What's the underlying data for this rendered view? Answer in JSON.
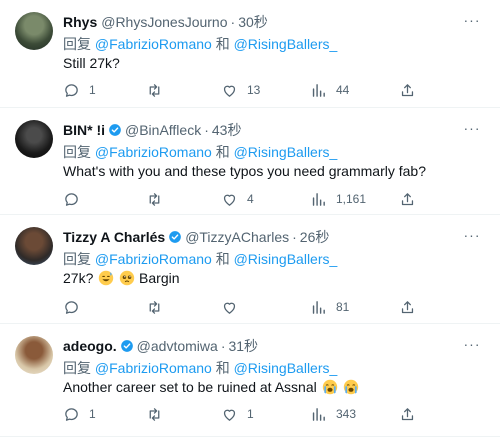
{
  "labels": {
    "reply_prefix": "回复",
    "and": "和",
    "more": "···"
  },
  "colors": {
    "accent": "#1d9bf0",
    "muted": "#536471",
    "text": "#0f1419"
  },
  "tweets": [
    {
      "name": "Rhys",
      "handle": "@RhysJonesJourno",
      "time": "30秒",
      "reply_to": [
        "@FabrizioRomano",
        "@RisingBallers_"
      ],
      "text": "Still 27k?",
      "emoji": [],
      "replies": "1",
      "retweets": "",
      "likes": "13",
      "views": "44",
      "icons": [
        "reply-icon",
        "retweet-icon",
        "like-icon",
        "views-icon",
        "share-icon"
      ]
    },
    {
      "name": "BIN* !i",
      "handle": "@BinAffleck",
      "time": "43秒",
      "reply_to": [
        "@FabrizioRomano",
        "@RisingBallers_"
      ],
      "text": "What's with you and these typos you need grammarly fab?",
      "emoji": [],
      "replies": "",
      "retweets": "",
      "likes": "4",
      "views": "1,161"
    },
    {
      "name": "Tizzy A Charlés",
      "handle": "@TizzyACharles",
      "time": "26秒",
      "reply_to": [
        "@FabrizioRomano",
        "@RisingBallers_"
      ],
      "text_before": "27k?",
      "text_after": "Bargin",
      "emoji": [
        "sweat-smile-emoji",
        "pleading-face-emoji"
      ],
      "replies": "",
      "retweets": "",
      "likes": "",
      "views": "81"
    },
    {
      "name": "adeogo.",
      "handle": "@advtomiwa",
      "time": "31秒",
      "reply_to": [
        "@FabrizioRomano",
        "@RisingBallers_"
      ],
      "text": "Another career set to be ruined at Assnal",
      "emoji": [
        "loudly-crying-emoji",
        "loudly-crying-emoji"
      ],
      "replies": "1",
      "retweets": "",
      "likes": "1",
      "views": "343"
    }
  ]
}
